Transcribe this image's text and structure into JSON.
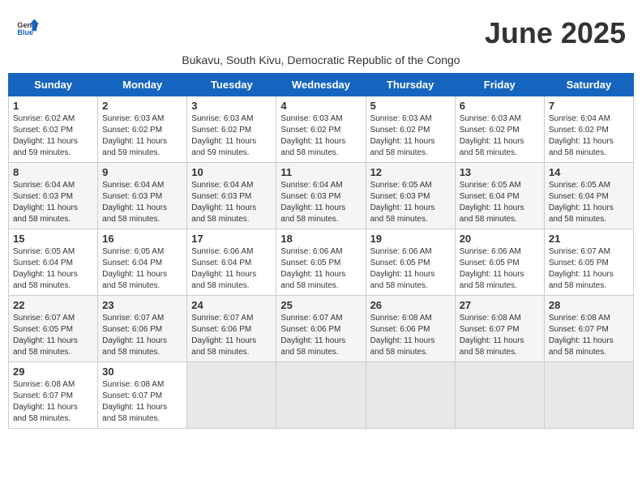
{
  "logo": {
    "general": "General",
    "blue": "Blue"
  },
  "title": "June 2025",
  "subtitle": "Bukavu, South Kivu, Democratic Republic of the Congo",
  "header_days": [
    "Sunday",
    "Monday",
    "Tuesday",
    "Wednesday",
    "Thursday",
    "Friday",
    "Saturday"
  ],
  "weeks": [
    [
      {
        "day": "1",
        "info": "Sunrise: 6:02 AM\nSunset: 6:02 PM\nDaylight: 11 hours\nand 59 minutes."
      },
      {
        "day": "2",
        "info": "Sunrise: 6:03 AM\nSunset: 6:02 PM\nDaylight: 11 hours\nand 59 minutes."
      },
      {
        "day": "3",
        "info": "Sunrise: 6:03 AM\nSunset: 6:02 PM\nDaylight: 11 hours\nand 59 minutes."
      },
      {
        "day": "4",
        "info": "Sunrise: 6:03 AM\nSunset: 6:02 PM\nDaylight: 11 hours\nand 58 minutes."
      },
      {
        "day": "5",
        "info": "Sunrise: 6:03 AM\nSunset: 6:02 PM\nDaylight: 11 hours\nand 58 minutes."
      },
      {
        "day": "6",
        "info": "Sunrise: 6:03 AM\nSunset: 6:02 PM\nDaylight: 11 hours\nand 58 minutes."
      },
      {
        "day": "7",
        "info": "Sunrise: 6:04 AM\nSunset: 6:02 PM\nDaylight: 11 hours\nand 58 minutes."
      }
    ],
    [
      {
        "day": "8",
        "info": "Sunrise: 6:04 AM\nSunset: 6:03 PM\nDaylight: 11 hours\nand 58 minutes."
      },
      {
        "day": "9",
        "info": "Sunrise: 6:04 AM\nSunset: 6:03 PM\nDaylight: 11 hours\nand 58 minutes."
      },
      {
        "day": "10",
        "info": "Sunrise: 6:04 AM\nSunset: 6:03 PM\nDaylight: 11 hours\nand 58 minutes."
      },
      {
        "day": "11",
        "info": "Sunrise: 6:04 AM\nSunset: 6:03 PM\nDaylight: 11 hours\nand 58 minutes."
      },
      {
        "day": "12",
        "info": "Sunrise: 6:05 AM\nSunset: 6:03 PM\nDaylight: 11 hours\nand 58 minutes."
      },
      {
        "day": "13",
        "info": "Sunrise: 6:05 AM\nSunset: 6:04 PM\nDaylight: 11 hours\nand 58 minutes."
      },
      {
        "day": "14",
        "info": "Sunrise: 6:05 AM\nSunset: 6:04 PM\nDaylight: 11 hours\nand 58 minutes."
      }
    ],
    [
      {
        "day": "15",
        "info": "Sunrise: 6:05 AM\nSunset: 6:04 PM\nDaylight: 11 hours\nand 58 minutes."
      },
      {
        "day": "16",
        "info": "Sunrise: 6:05 AM\nSunset: 6:04 PM\nDaylight: 11 hours\nand 58 minutes."
      },
      {
        "day": "17",
        "info": "Sunrise: 6:06 AM\nSunset: 6:04 PM\nDaylight: 11 hours\nand 58 minutes."
      },
      {
        "day": "18",
        "info": "Sunrise: 6:06 AM\nSunset: 6:05 PM\nDaylight: 11 hours\nand 58 minutes."
      },
      {
        "day": "19",
        "info": "Sunrise: 6:06 AM\nSunset: 6:05 PM\nDaylight: 11 hours\nand 58 minutes."
      },
      {
        "day": "20",
        "info": "Sunrise: 6:06 AM\nSunset: 6:05 PM\nDaylight: 11 hours\nand 58 minutes."
      },
      {
        "day": "21",
        "info": "Sunrise: 6:07 AM\nSunset: 6:05 PM\nDaylight: 11 hours\nand 58 minutes."
      }
    ],
    [
      {
        "day": "22",
        "info": "Sunrise: 6:07 AM\nSunset: 6:05 PM\nDaylight: 11 hours\nand 58 minutes."
      },
      {
        "day": "23",
        "info": "Sunrise: 6:07 AM\nSunset: 6:06 PM\nDaylight: 11 hours\nand 58 minutes."
      },
      {
        "day": "24",
        "info": "Sunrise: 6:07 AM\nSunset: 6:06 PM\nDaylight: 11 hours\nand 58 minutes."
      },
      {
        "day": "25",
        "info": "Sunrise: 6:07 AM\nSunset: 6:06 PM\nDaylight: 11 hours\nand 58 minutes."
      },
      {
        "day": "26",
        "info": "Sunrise: 6:08 AM\nSunset: 6:06 PM\nDaylight: 11 hours\nand 58 minutes."
      },
      {
        "day": "27",
        "info": "Sunrise: 6:08 AM\nSunset: 6:07 PM\nDaylight: 11 hours\nand 58 minutes."
      },
      {
        "day": "28",
        "info": "Sunrise: 6:08 AM\nSunset: 6:07 PM\nDaylight: 11 hours\nand 58 minutes."
      }
    ],
    [
      {
        "day": "29",
        "info": "Sunrise: 6:08 AM\nSunset: 6:07 PM\nDaylight: 11 hours\nand 58 minutes."
      },
      {
        "day": "30",
        "info": "Sunrise: 6:08 AM\nSunset: 6:07 PM\nDaylight: 11 hours\nand 58 minutes."
      },
      null,
      null,
      null,
      null,
      null
    ]
  ]
}
